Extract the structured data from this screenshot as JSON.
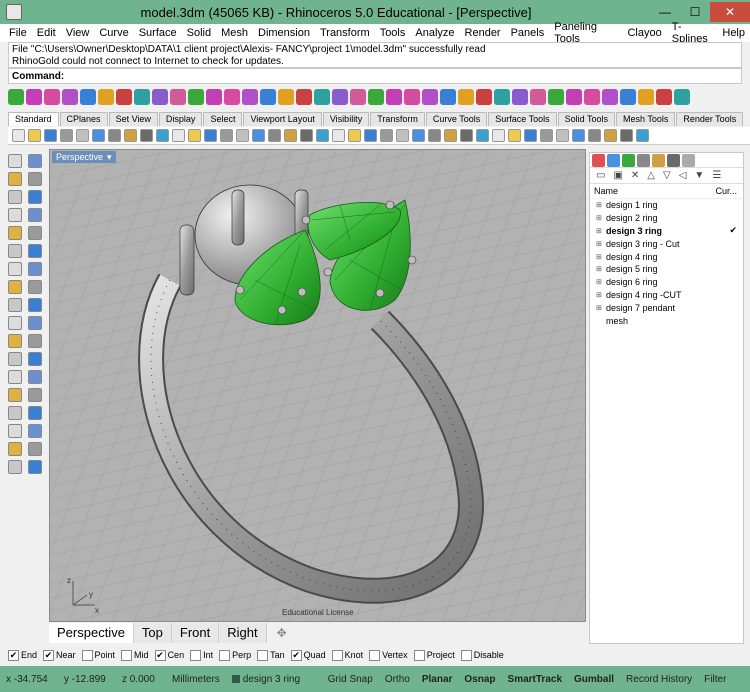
{
  "window": {
    "title": "model.3dm (45065 KB) - Rhinoceros 5.0 Educational - [Perspective]",
    "minimize": "—",
    "maximize": "☐",
    "close": "✕"
  },
  "menu": [
    "File",
    "Edit",
    "View",
    "Curve",
    "Surface",
    "Solid",
    "Mesh",
    "Dimension",
    "Transform",
    "Tools",
    "Analyze",
    "Render",
    "Panels",
    "Paneling Tools",
    "Clayoo",
    "T-Splines",
    "Help"
  ],
  "command": {
    "history_line1": "File \"C:\\Users\\Owner\\Desktop\\DATA\\1 client project\\Alexis- FANCY\\project 1\\model.3dm\" successfully read",
    "history_line2": "RhinoGold could not connect to Internet to check for updates.",
    "label": "Command:",
    "value": ""
  },
  "toolbar_tabs": [
    "Standard",
    "CPlanes",
    "Set View",
    "Display",
    "Select",
    "Viewport Layout",
    "Visibility",
    "Transform",
    "Curve Tools",
    "Surface Tools",
    "Solid Tools",
    "Mesh Tools",
    "Render Tools"
  ],
  "active_toolbar_tab": "Standard",
  "viewport": {
    "title": "Perspective",
    "dropdown": "▾",
    "watermark": "Educational License",
    "axis_x": "x",
    "axis_y": "y",
    "axis_z": "z"
  },
  "viewport_tabs": [
    "Perspective",
    "Top",
    "Front",
    "Right"
  ],
  "viewport_tab_add": "✥",
  "layers": {
    "header_name": "Name",
    "header_current": "Cur...",
    "toolbar_icons": [
      "new-layer",
      "new-sublayer",
      "delete",
      "move-up",
      "move-down",
      "move-up-parent",
      "filter",
      "menu"
    ],
    "items": [
      {
        "name": "design 1 ring",
        "expandable": true
      },
      {
        "name": "design 2 ring",
        "expandable": true
      },
      {
        "name": "design 3 ring",
        "expandable": true,
        "current": true
      },
      {
        "name": "design 3 ring - Cut",
        "expandable": true
      },
      {
        "name": "design 4 ring",
        "expandable": true
      },
      {
        "name": "design 5 ring",
        "expandable": true
      },
      {
        "name": "design 6 ring",
        "expandable": true
      },
      {
        "name": "design 4 ring -CUT",
        "expandable": true
      },
      {
        "name": "design 7 pendant",
        "expandable": true
      },
      {
        "name": "mesh",
        "expandable": false
      }
    ],
    "current_mark": "✔"
  },
  "osnap": [
    {
      "label": "End",
      "checked": true
    },
    {
      "label": "Near",
      "checked": true
    },
    {
      "label": "Point",
      "checked": false
    },
    {
      "label": "Mid",
      "checked": false
    },
    {
      "label": "Cen",
      "checked": true
    },
    {
      "label": "Int",
      "checked": false
    },
    {
      "label": "Perp",
      "checked": false
    },
    {
      "label": "Tan",
      "checked": false
    },
    {
      "label": "Quad",
      "checked": true
    },
    {
      "label": "Knot",
      "checked": false
    },
    {
      "label": "Vertex",
      "checked": false
    },
    {
      "label": "Project",
      "checked": false
    },
    {
      "label": "Disable",
      "checked": false
    }
  ],
  "status": {
    "x": "x -34.754",
    "y": "y -12.899",
    "z": "z 0.000",
    "units": "Millimeters",
    "layer": "design 3 ring",
    "layer_color": "#2e5a4a",
    "toggles": [
      "Grid Snap",
      "Ortho",
      "Planar",
      "Osnap",
      "SmartTrack",
      "Gumball",
      "Record History",
      "Filter"
    ],
    "bold_toggles": [
      "Planar",
      "Osnap",
      "SmartTrack",
      "Gumball"
    ]
  },
  "colors": {
    "titlebar": "#6fb48e",
    "viewport_bg": "#b2b2b2",
    "gem": "#2fae2f",
    "accent": "#6b8fb8"
  }
}
